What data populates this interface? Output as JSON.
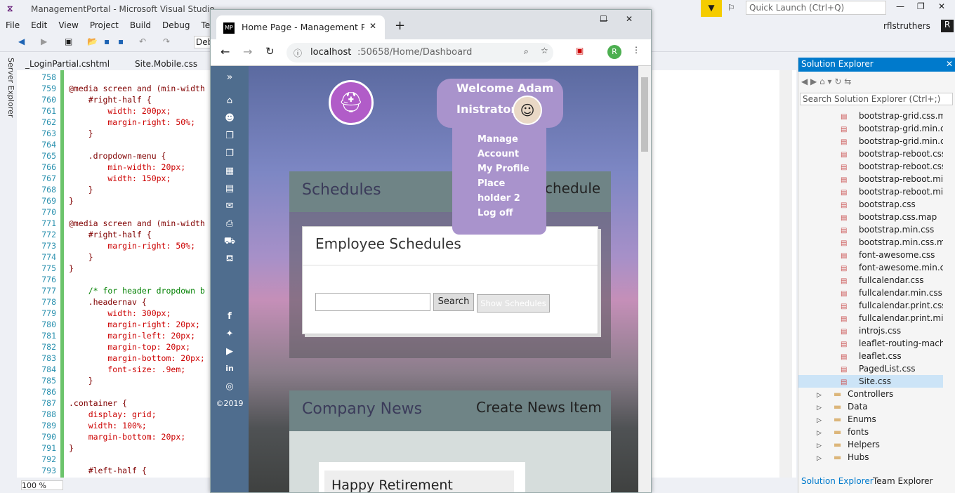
{
  "vs": {
    "title": "ManagementPortal - Microsoft Visual Studio",
    "menus": [
      "File",
      "Edit",
      "View",
      "Project",
      "Build",
      "Debug",
      "Te"
    ],
    "quick_launch": "Quick Launch (Ctrl+Q)",
    "user": "rflstruthers",
    "user_initial": "R",
    "debug_combo": "Deb",
    "server_explorer": "Server Explorer",
    "tabs": [
      "_LoginPartial.cshtml",
      "Site.Mobile.css"
    ],
    "zoom": "100 %",
    "code": [
      {
        "n": "758",
        "t": ""
      },
      {
        "n": "759",
        "t": "@media screen and (min-width"
      },
      {
        "n": "760",
        "t": "    #right-half {"
      },
      {
        "n": "761",
        "t": "        width: 200px;"
      },
      {
        "n": "762",
        "t": "        margin-right: 50%;"
      },
      {
        "n": "763",
        "t": "    }"
      },
      {
        "n": "764",
        "t": ""
      },
      {
        "n": "765",
        "t": "    .dropdown-menu {"
      },
      {
        "n": "766",
        "t": "        min-width: 20px;"
      },
      {
        "n": "767",
        "t": "        width: 150px;"
      },
      {
        "n": "768",
        "t": "    }"
      },
      {
        "n": "769",
        "t": "}"
      },
      {
        "n": "770",
        "t": ""
      },
      {
        "n": "771",
        "t": "@media screen and (min-width"
      },
      {
        "n": "772",
        "t": "    #right-half {"
      },
      {
        "n": "773",
        "t": "        margin-right: 50%;"
      },
      {
        "n": "774",
        "t": "    }"
      },
      {
        "n": "775",
        "t": "}"
      },
      {
        "n": "776",
        "t": ""
      },
      {
        "n": "777",
        "t": "    /* for header dropdown b"
      },
      {
        "n": "778",
        "t": "    .headernav {"
      },
      {
        "n": "779",
        "t": "        width: 300px;"
      },
      {
        "n": "780",
        "t": "        margin-right: 20px;"
      },
      {
        "n": "781",
        "t": "        margin-left: 20px;"
      },
      {
        "n": "782",
        "t": "        margin-top: 20px;"
      },
      {
        "n": "783",
        "t": "        margin-bottom: 20px;"
      },
      {
        "n": "784",
        "t": "        font-size: .9em;"
      },
      {
        "n": "785",
        "t": "    }"
      },
      {
        "n": "786",
        "t": ""
      },
      {
        "n": "787",
        "t": ".container {"
      },
      {
        "n": "788",
        "t": "    display: grid;"
      },
      {
        "n": "789",
        "t": "    width: 100%;"
      },
      {
        "n": "790",
        "t": "    margin-bottom: 20px;"
      },
      {
        "n": "791",
        "t": "}"
      },
      {
        "n": "792",
        "t": ""
      },
      {
        "n": "793",
        "t": "    #left-half {"
      }
    ]
  },
  "browser": {
    "tab_title": "Home Page - Management Porta",
    "url_host": "localhost",
    "url_rest": ":50658/Home/Dashboard",
    "profile_initial": "R"
  },
  "site": {
    "welcome": "Welcome Adam",
    "welcome2": "Inistrator",
    "menu": [
      "Manage",
      "Account",
      "My Profile",
      "Place",
      "holder 2",
      "Log off"
    ],
    "schedules_title": "Schedules",
    "schedule_link": "chedule",
    "employee_schedules": "Employee Schedules",
    "search_btn": "Search",
    "show_btn": "Show Schedules",
    "news_title": "Company News",
    "create_news": "Create News Item",
    "news_item": "Happy Retirement",
    "copyright": "©2019"
  },
  "solution": {
    "title": "Solution Explorer",
    "search": "Search Solution Explorer (Ctrl+;)",
    "files": [
      "bootstrap-grid.css.map",
      "bootstrap-grid.min.css",
      "bootstrap-grid.min.css",
      "bootstrap-reboot.css",
      "bootstrap-reboot.css.m",
      "bootstrap-reboot.min.",
      "bootstrap-reboot.min.",
      "bootstrap.css",
      "bootstrap.css.map",
      "bootstrap.min.css",
      "bootstrap.min.css.map",
      "font-awesome.css",
      "font-awesome.min.css",
      "fullcalendar.css",
      "fullcalendar.min.css",
      "fullcalendar.print.css",
      "fullcalendar.print.min.",
      "introjs.css",
      "leaflet-routing-machin",
      "leaflet.css",
      "PagedList.css",
      "Site.css"
    ],
    "folders": [
      "Controllers",
      "Data",
      "Enums",
      "fonts",
      "Helpers",
      "Hubs"
    ],
    "bottom_tabs": [
      "Solution Explorer",
      "Team Explorer"
    ]
  }
}
